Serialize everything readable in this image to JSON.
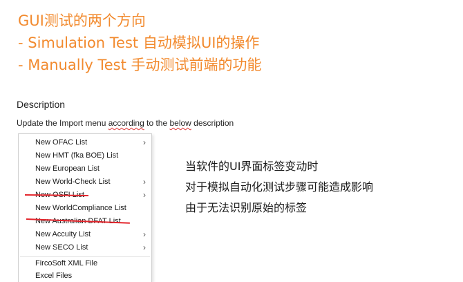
{
  "headlines": {
    "line1": "GUI测试的两个方向",
    "line2": "- Simulation Test 自动模拟UI的操作",
    "line3": "- Manually Test 手动测试前端的功能"
  },
  "description": {
    "heading": "Description",
    "text_before": "Update the Import menu ",
    "text_according": "according",
    "text_middle": " to the ",
    "text_below": "below",
    "text_after": " description"
  },
  "menu": {
    "items": [
      {
        "label": "New OFAC List",
        "has_submenu": true,
        "struck": false
      },
      {
        "label": "New HMT (fka BOE) List",
        "has_submenu": false,
        "struck": false
      },
      {
        "label": "New European List",
        "has_submenu": false,
        "struck": false
      },
      {
        "label": "New World-Check List",
        "has_submenu": true,
        "struck": false
      },
      {
        "label": "New OSFI List",
        "has_submenu": true,
        "struck": true
      },
      {
        "label": "New WorldCompliance List",
        "has_submenu": false,
        "struck": false
      },
      {
        "label": "New Australian DFAT List",
        "has_submenu": false,
        "struck": true
      },
      {
        "label": "New Accuity List",
        "has_submenu": true,
        "struck": false
      },
      {
        "label": "New SECO List",
        "has_submenu": true,
        "struck": false
      },
      {
        "label": "FircoSoft XML File",
        "has_submenu": false,
        "struck": false
      },
      {
        "label": "Excel Files",
        "has_submenu": false,
        "struck": false
      }
    ],
    "submenu_glyph": "›",
    "strike_color": "#e3242b"
  },
  "notes": {
    "line1": "当软件的UI界面标签变动时",
    "line2": "对于模拟自动化测试步骤可能造成影响",
    "line3": "由于无法识别原始的标签"
  },
  "colors": {
    "headline": "#f28a2e",
    "text": "#222222"
  }
}
